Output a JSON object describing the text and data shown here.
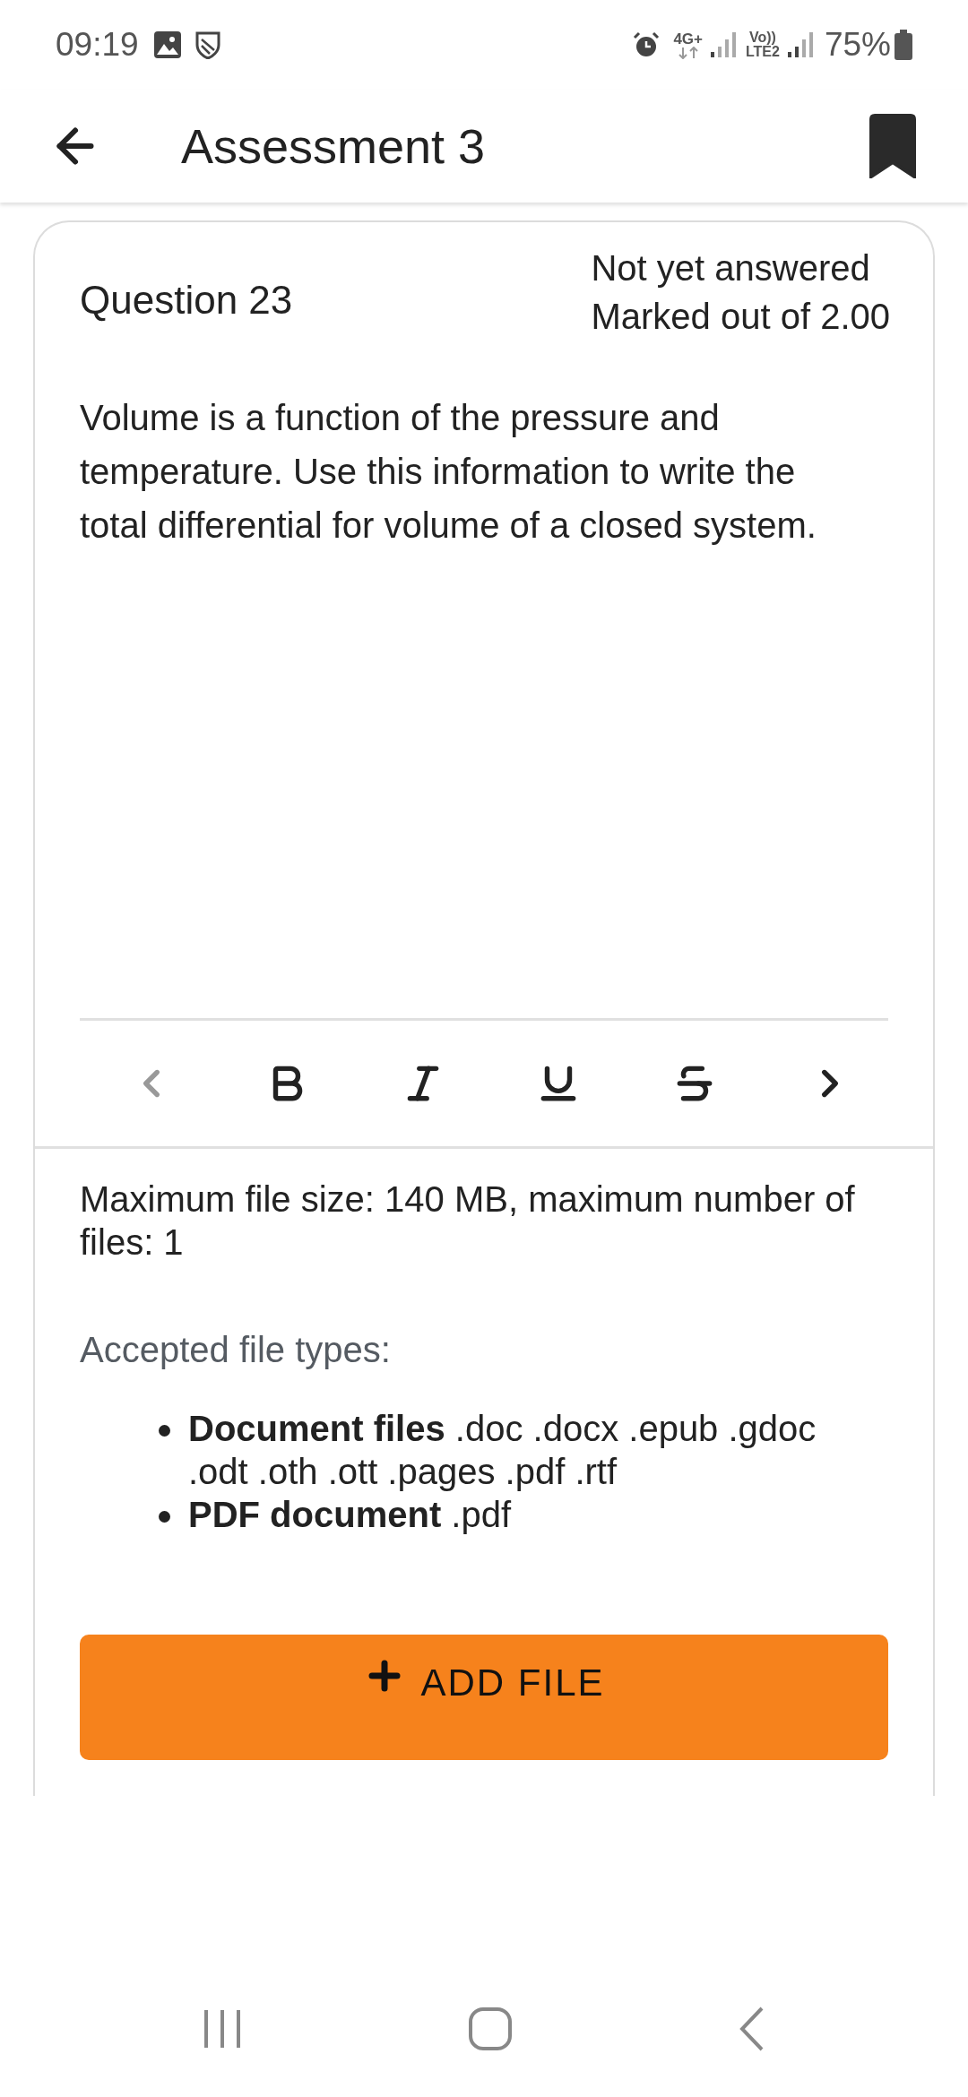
{
  "status_bar": {
    "time": "09:19",
    "network": "4G+",
    "volte": "Vo))",
    "lte": "LTE2",
    "battery": "75%"
  },
  "app_bar": {
    "title": "Assessment 3",
    "bookmarked": true
  },
  "question": {
    "title": "Question 23",
    "status": "Not yet answered",
    "marks": "Marked out of 2.00",
    "text": "Volume is a function of the pressure and temperature. Use this information to write the total differential for volume of a closed system."
  },
  "editor": {
    "toolbar": [
      {
        "kind": "prev",
        "disabled": true
      },
      {
        "kind": "bold",
        "disabled": false
      },
      {
        "kind": "italic",
        "disabled": false
      },
      {
        "kind": "underline",
        "disabled": false
      },
      {
        "kind": "strikethrough",
        "disabled": false
      },
      {
        "kind": "next",
        "disabled": false
      }
    ]
  },
  "upload": {
    "limits": "Maximum file size: 140 MB, maximum number of files: 1",
    "accepted_label": "Accepted file types:",
    "file_types": [
      "**Document files** .doc .docx .epub .gdoc .odt .oth .ott .pages .pdf .rtf",
      "**PDF document** .pdf"
    ],
    "button": "ADD FILE"
  }
}
